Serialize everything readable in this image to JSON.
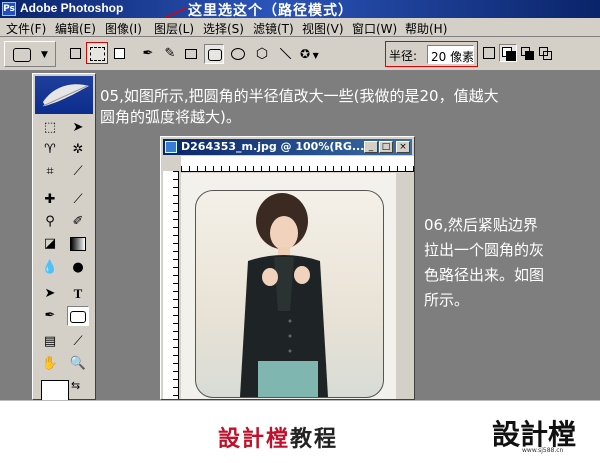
{
  "window": {
    "title": "Adobe Photoshop",
    "annotation": "这里选这个（路径模式）"
  },
  "menu": [
    "文件(F)",
    "编辑(E)",
    "图像(I)",
    "图层(L)",
    "选择(S)",
    "滤镜(T)",
    "视图(V)",
    "窗口(W)",
    "帮助(H)"
  ],
  "options": {
    "radius_label": "半径:",
    "radius_value": "20 像素"
  },
  "colors": {
    "highlight": "#e00000",
    "titlebar": "#0a246a",
    "workspace": "#7e7e7e",
    "brand_red": "#c0102a"
  },
  "instructions": {
    "step05_line1": "05,如图所示,把圆角的半径值改大一些(我做的是20，值越大",
    "step05_line2": "圆角的弧度将越大)。",
    "step06_line1": "06,然后紧贴边界",
    "step06_line2": "拉出一个圆角的灰",
    "step06_line3": "色路径出来。如图",
    "step06_line4": "所示。"
  },
  "document": {
    "title": "D264353_m.jpg @ 100%(RG...",
    "btn_min": "_",
    "btn_max": "□",
    "btn_close": "×"
  },
  "footer": {
    "brand_red": "設計樘",
    "brand_black": "教程",
    "logo_text": "設計樘",
    "logo_url": "www.sj588.cn"
  }
}
